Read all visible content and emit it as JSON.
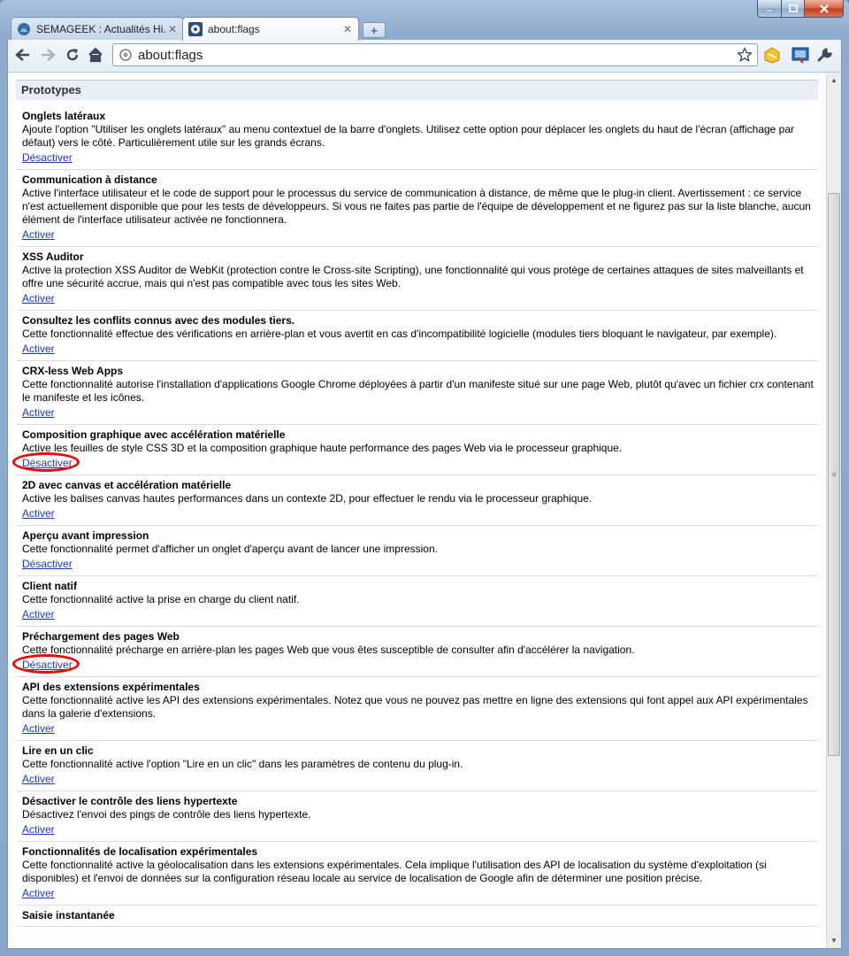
{
  "window": {
    "controls": {
      "minimize": "minimize-icon",
      "maximize": "maximize-icon",
      "close": "close-icon"
    }
  },
  "tabs": [
    {
      "title": "SEMAGEEK : Actualités Hi...",
      "active": false
    },
    {
      "title": "about:flags",
      "active": true
    }
  ],
  "toolbar": {
    "address": "about:flags",
    "icons": [
      "back-arrow-icon",
      "forward-arrow-icon",
      "reload-icon",
      "home-icon",
      "page-icon",
      "star-icon",
      "extension-icon",
      "screen-capture-icon",
      "wrench-icon"
    ]
  },
  "section": {
    "title": "Prototypes"
  },
  "experiments": [
    {
      "name": "Onglets latéraux",
      "desc": "Ajoute l'option \"Utiliser les onglets latéraux\" au menu contextuel de la barre d'onglets. Utilisez cette option pour déplacer les onglets du haut de l'écran (affichage par défaut) vers le côté. Particulièrement utile sur les grands écrans.",
      "action": "Désactiver",
      "marked": false
    },
    {
      "name": "Communication à distance",
      "desc": "Active l'interface utilisateur et le code de support pour le processus du service de communication à distance, de même que le plug-in client. Avertissement : ce service n'est actuellement disponible que pour les tests de développeurs. Si vous ne faites pas partie de l'équipe de développement et ne figurez pas sur la liste blanche, aucun élément de l'interface utilisateur activée ne fonctionnera.",
      "action": "Activer",
      "marked": false
    },
    {
      "name": "XSS Auditor",
      "desc": "Active la protection XSS Auditor de WebKit (protection contre le Cross-site Scripting), une fonctionnalité qui vous protège de certaines attaques de sites malveillants et offre une sécurité accrue, mais qui n'est pas compatible avec tous les sites Web.",
      "action": "Activer",
      "marked": false
    },
    {
      "name": "Consultez les conflits connus avec des modules tiers.",
      "desc": "Cette fonctionnalité effectue des vérifications en arrière-plan et vous avertit en cas d'incompatibilité logicielle (modules tiers bloquant le navigateur, par exemple).",
      "action": "Activer",
      "marked": false
    },
    {
      "name": "CRX-less Web Apps",
      "desc": "Cette fonctionnalité autorise l'installation d'applications Google Chrome déployées à partir d'un manifeste situé sur une page Web, plutôt qu'avec un fichier crx contenant le manifeste et les icônes.",
      "action": "Activer",
      "marked": false
    },
    {
      "name": "Composition graphique avec accélération matérielle",
      "desc": "Active les feuilles de style CSS 3D et la composition graphique haute performance des pages Web via le processeur graphique.",
      "action": "Désactiver",
      "marked": true
    },
    {
      "name": "2D avec canvas et accélération matérielle",
      "desc": "Active les balises canvas hautes performances dans un contexte 2D, pour effectuer le rendu via le processeur graphique.",
      "action": "Activer",
      "marked": false
    },
    {
      "name": "Aperçu avant impression",
      "desc": "Cette fonctionnalité permet d'afficher un onglet d'aperçu avant de lancer une impression.",
      "action": "Désactiver",
      "marked": false
    },
    {
      "name": "Client natif",
      "desc": "Cette fonctionnalité active la prise en charge du client natif.",
      "action": "Activer",
      "marked": false
    },
    {
      "name": "Préchargement des pages Web",
      "desc": "Cette fonctionnalité précharge en arrière-plan les pages Web que vous êtes susceptible de consulter afin d'accélérer la navigation.",
      "action": "Désactiver",
      "marked": true
    },
    {
      "name": "API des extensions expérimentales",
      "desc": "Cette fonctionnalité active les API des extensions expérimentales. Notez que vous ne pouvez pas mettre en ligne des extensions qui font appel aux API expérimentales dans la galerie d'extensions.",
      "action": "Activer",
      "marked": false
    },
    {
      "name": "Lire en un clic",
      "desc": "Cette fonctionnalité active l'option \"Lire en un clic\" dans les paramètres de contenu du plug-in.",
      "action": "Activer",
      "marked": false
    },
    {
      "name": "Désactiver le contrôle des liens hypertexte",
      "desc": "Désactivez l'envoi des pings de contrôle des liens hypertexte.",
      "action": "Activer",
      "marked": false
    },
    {
      "name": "Fonctionnalités de localisation expérimentales",
      "desc": "Cette fonctionnalité active la géolocalisation dans les extensions expérimentales. Cela implique l'utilisation des API de localisation du système d'exploitation (si disponibles) et l'envoi de données sur la configuration réseau locale au service de localisation de Google afin de déterminer une position précise.",
      "action": "Activer",
      "marked": false
    },
    {
      "name": "Saisie instantanée",
      "desc": "",
      "action": "",
      "marked": false
    }
  ],
  "colors": {
    "link": "#1a3ab8",
    "highlight_circle": "#e10a0a",
    "section_bg": "#e8eef7"
  }
}
